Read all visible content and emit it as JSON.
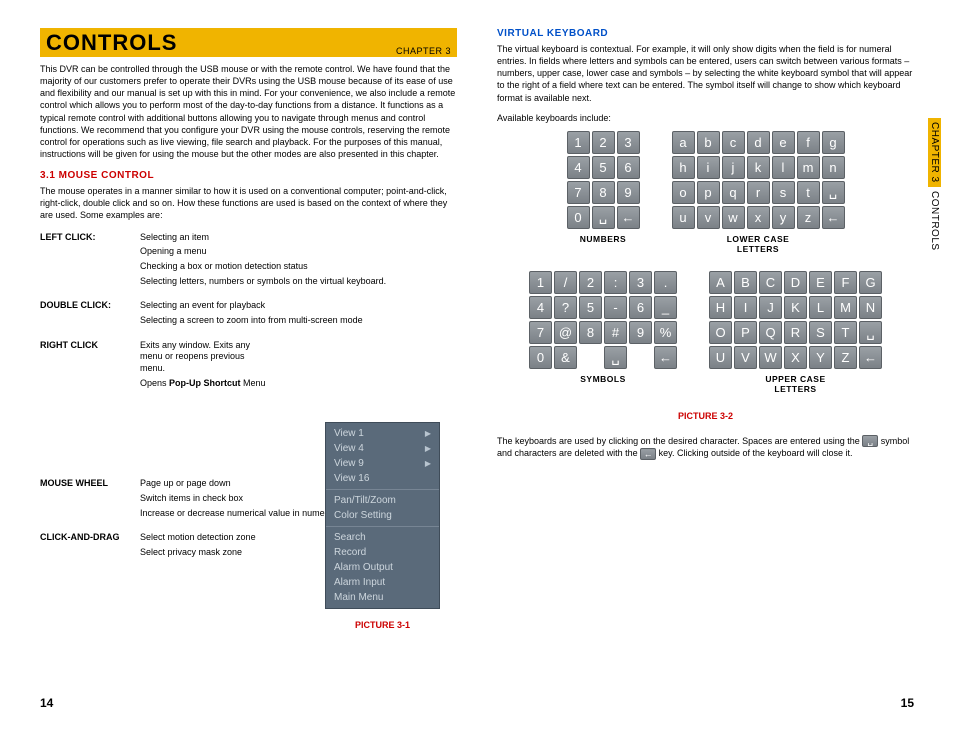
{
  "header": {
    "title": "CONTROLS",
    "chapter": "CHAPTER 3"
  },
  "side_tab": {
    "chapter": "CHAPTER 3",
    "name": "CONTROLS"
  },
  "intro": "This DVR can be controlled through the USB mouse or with the remote control. We have found that the majority of our customers prefer to operate their DVRs using the USB mouse because of its ease of use and flexibility and our manual is set up with this in mind. For your convenience, we also include a remote control which allows you to perform most of the day-to-day functions from a distance. It functions as a typical remote control with additional buttons allowing you to navigate through menus and control functions.  We recommend that you configure your DVR using the mouse controls, reserving the remote control for operations such as live viewing, file search and playback. For the purposes of this manual, instructions will be given for using the mouse but the other modes are also presented in this chapter.",
  "mouse": {
    "heading": "3.1 MOUSE CONTROL",
    "intro": "The mouse operates in a manner similar to how it is used on a conventional computer; point-and-click, right-click, double click and so on. How these functions are used is based on the context of where they are used. Some examples are:",
    "groups": [
      {
        "label": "LEFT CLICK:",
        "items": [
          "Selecting an item",
          "Opening a menu",
          "Checking a box or motion detection status",
          "Selecting letters, numbers or symbols on the virtual keyboard."
        ]
      },
      {
        "label": "DOUBLE CLICK:",
        "items": [
          "Selecting an event for playback",
          "Selecting a screen to zoom into from multi-screen mode"
        ]
      },
      {
        "label": "RIGHT CLICK",
        "items_rich": true
      },
      {
        "label": "MOUSE WHEEL",
        "items": [
          "Page up or page down",
          "Switch items in check box",
          "Increase or decrease numerical value in numerical input box"
        ]
      },
      {
        "label": "CLICK-AND-DRAG",
        "items": [
          "Select motion detection zone",
          "Select privacy mask zone"
        ]
      }
    ],
    "right_click": {
      "line1": "Exits any window. Exits any menu or reopens previous menu.",
      "line2a": "Opens ",
      "line2b": "Pop-Up Shortcut",
      "line2c": " Menu"
    }
  },
  "shortcut_menu": {
    "groups": [
      {
        "items": [
          {
            "label": "View 1",
            "arrow": true
          },
          {
            "label": "View 4",
            "arrow": true
          },
          {
            "label": "View 9",
            "arrow": true
          },
          {
            "label": "View 16",
            "arrow": false
          }
        ]
      },
      {
        "items": [
          {
            "label": "Pan/Tilt/Zoom",
            "arrow": false
          },
          {
            "label": "Color Setting",
            "arrow": false
          }
        ]
      },
      {
        "items": [
          {
            "label": "Search",
            "arrow": false
          },
          {
            "label": "Record",
            "arrow": false
          },
          {
            "label": "Alarm Output",
            "arrow": false
          },
          {
            "label": "Alarm Input",
            "arrow": false
          },
          {
            "label": "Main Menu",
            "arrow": false
          }
        ]
      }
    ],
    "caption": "PICTURE 3-1"
  },
  "vk": {
    "heading": "VIRTUAL KEYBOARD",
    "intro": "The virtual keyboard is contextual. For example, it will only show digits when the field is for numeral entries. In fields where letters and symbols can be entered, users can switch between various formats – numbers, upper case, lower case and symbols – by selecting the white keyboard symbol that will appear to the right of a field where text can be entered. The symbol itself will change to show which keyboard format is available next.",
    "available": "Available keyboards include:",
    "keyboards": {
      "numbers": {
        "label": "NUMBERS",
        "rows": [
          [
            "1",
            "2",
            "3"
          ],
          [
            "4",
            "5",
            "6"
          ],
          [
            "7",
            "8",
            "9"
          ],
          [
            "0",
            "␣",
            "←"
          ]
        ]
      },
      "lower": {
        "label": "LOWER CASE LETTERS",
        "rows": [
          [
            "a",
            "b",
            "c",
            "d",
            "e",
            "f",
            "g"
          ],
          [
            "h",
            "i",
            "j",
            "k",
            "l",
            "m",
            "n"
          ],
          [
            "o",
            "p",
            "q",
            "r",
            "s",
            "t",
            "␣"
          ],
          [
            "u",
            "v",
            "w",
            "x",
            "y",
            "z",
            "←"
          ]
        ]
      },
      "symbols": {
        "label": "SYMBOLS",
        "rows": [
          [
            "1",
            "/",
            "2",
            ":",
            "3",
            "."
          ],
          [
            "4",
            "?",
            "5",
            "-",
            "6",
            "_"
          ],
          [
            "7",
            "@",
            "8",
            "#",
            "9",
            "%"
          ],
          [
            "0",
            "&",
            "",
            "␣",
            "",
            "←"
          ]
        ]
      },
      "upper": {
        "label": "UPPER CASE LETTERS",
        "rows": [
          [
            "A",
            "B",
            "C",
            "D",
            "E",
            "F",
            "G"
          ],
          [
            "H",
            "I",
            "J",
            "K",
            "L",
            "M",
            "N"
          ],
          [
            "O",
            "P",
            "Q",
            "R",
            "S",
            "T",
            "␣"
          ],
          [
            "U",
            "V",
            "W",
            "X",
            "Y",
            "Z",
            "←"
          ]
        ]
      }
    },
    "caption": "PICTURE 3-2",
    "usage_a": "The keyboards are used by clicking on the desired character. Spaces are entered using the ",
    "usage_b": " symbol and characters are deleted with the ",
    "usage_c": " key. Clicking outside of the keyboard will close it."
  },
  "page_left": "14",
  "page_right": "15"
}
